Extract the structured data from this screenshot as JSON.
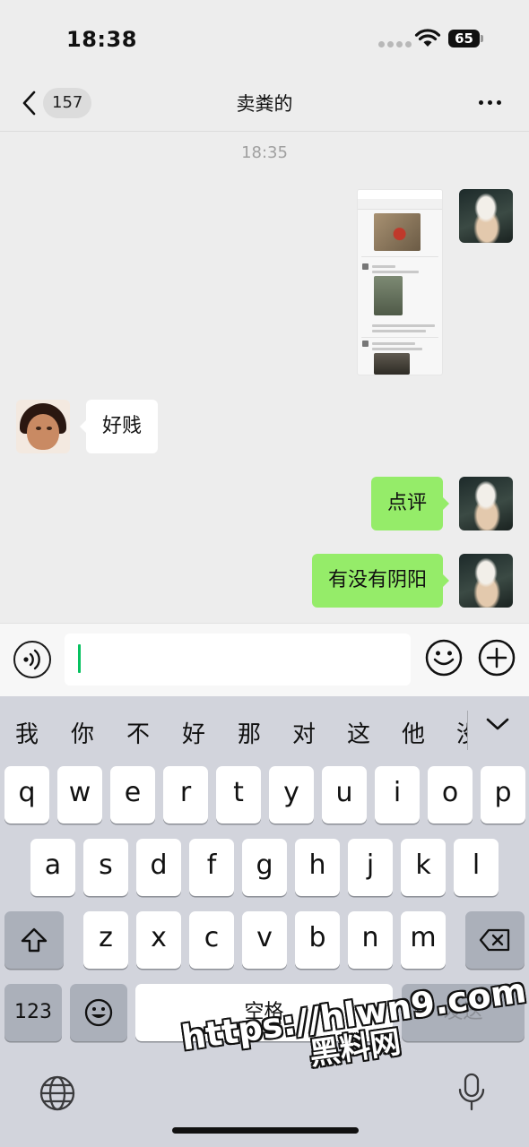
{
  "status_bar": {
    "time": "18:38",
    "battery": "65"
  },
  "header": {
    "unread_count": "157",
    "title": "卖粪的"
  },
  "messages": {
    "timestamp": "18:35",
    "items": [
      {
        "from": "me",
        "type": "image",
        "content": "聊天截图"
      },
      {
        "from": "other",
        "type": "text",
        "text": "好贱"
      },
      {
        "from": "me",
        "type": "text",
        "text": "点评"
      },
      {
        "from": "me",
        "type": "text",
        "text": "有没有阴阳"
      }
    ]
  },
  "input": {
    "value": ""
  },
  "keyboard": {
    "candidates": [
      "我",
      "你",
      "不",
      "好",
      "那",
      "对",
      "这",
      "他",
      "没"
    ],
    "row1": [
      "q",
      "w",
      "e",
      "r",
      "t",
      "y",
      "u",
      "i",
      "o",
      "p"
    ],
    "row2": [
      "a",
      "s",
      "d",
      "f",
      "g",
      "h",
      "j",
      "k",
      "l"
    ],
    "row3": [
      "z",
      "x",
      "c",
      "v",
      "b",
      "n",
      "m"
    ],
    "numbers_label": "123",
    "space_label": "空格",
    "send_label": "发送"
  },
  "watermark": {
    "line1": "https://hlwn9.com",
    "line2": "黑料网"
  },
  "colors": {
    "accent_green": "#95ec69",
    "caret_green": "#07c160",
    "background": "#ededed",
    "keyboard_bg": "#d2d4dc"
  }
}
